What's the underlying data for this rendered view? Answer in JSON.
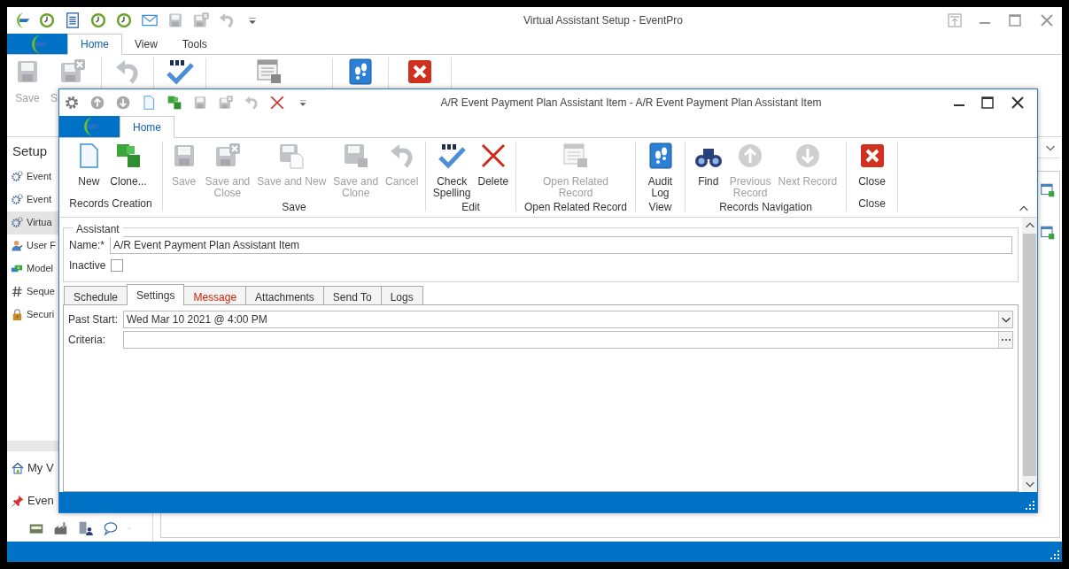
{
  "main_window": {
    "title": "Virtual Assistant Setup - EventPro",
    "ribbon_tabs": [
      {
        "label": "Home",
        "selected": true
      },
      {
        "label": "View",
        "selected": false
      },
      {
        "label": "Tools",
        "selected": false
      }
    ],
    "ribbon_buttons": [
      {
        "label": "Save"
      },
      {
        "label": "S"
      }
    ],
    "sidebar": {
      "title": "Setup",
      "items": [
        {
          "label": "Event",
          "kind": "gear",
          "selected": false
        },
        {
          "label": "Event",
          "kind": "gear",
          "selected": false
        },
        {
          "label": "Virtua",
          "kind": "gear",
          "selected": true
        },
        {
          "label": "User F",
          "kind": "user",
          "selected": false
        },
        {
          "label": "Model",
          "kind": "cash",
          "selected": false
        },
        {
          "label": "Seque",
          "kind": "hash",
          "selected": false
        },
        {
          "label": "Securi",
          "kind": "lock",
          "selected": false
        }
      ],
      "bottom_items": [
        {
          "label": "My V",
          "kind": "home"
        },
        {
          "label": "Even",
          "kind": "pin"
        }
      ]
    }
  },
  "dialog": {
    "title": "A/R Event Payment Plan Assistant Item - A/R Event Payment Plan Assistant Item",
    "ribbon_tabs": [
      {
        "label": "Home",
        "selected": true
      }
    ],
    "ribbon_groups": [
      {
        "label": "Records Creation",
        "buttons": [
          {
            "kind": "new",
            "label": "New",
            "disabled": false
          },
          {
            "kind": "clone",
            "label": "Clone...",
            "disabled": false
          }
        ]
      },
      {
        "label": "Save",
        "buttons": [
          {
            "kind": "save",
            "label": "Save",
            "disabled": true
          },
          {
            "kind": "save-close",
            "label": "Save and\nClose",
            "disabled": true
          },
          {
            "kind": "save-new",
            "label": "Save and New",
            "disabled": true
          },
          {
            "kind": "save-clone",
            "label": "Save and\nClone",
            "disabled": true
          },
          {
            "kind": "undo",
            "label": "Cancel",
            "disabled": true
          }
        ]
      },
      {
        "label": "Edit",
        "buttons": [
          {
            "kind": "spell",
            "label": "Check\nSpelling",
            "disabled": false
          },
          {
            "kind": "delete",
            "label": "Delete",
            "disabled": false
          }
        ]
      },
      {
        "label": "Open Related Record",
        "buttons": [
          {
            "kind": "related",
            "label": "Open Related\nRecord",
            "disabled": true
          }
        ]
      },
      {
        "label": "View",
        "buttons": [
          {
            "kind": "audit",
            "label": "Audit\nLog",
            "disabled": false
          }
        ]
      },
      {
        "label": "Records Navigation",
        "buttons": [
          {
            "kind": "find",
            "label": "Find",
            "disabled": false
          },
          {
            "kind": "up",
            "label": "Previous\nRecord",
            "disabled": true
          },
          {
            "kind": "down",
            "label": "Next Record",
            "disabled": true
          }
        ]
      },
      {
        "label": "Close",
        "buttons": [
          {
            "kind": "close",
            "label": "Close",
            "disabled": false
          }
        ]
      }
    ],
    "assistant": {
      "title": "Assistant",
      "name_label": "Name:*",
      "name": "A/R Event Payment Plan Assistant Item",
      "inactive_label": "Inactive",
      "inactive": false
    },
    "tabs": [
      {
        "label": "Schedule",
        "selected": false,
        "alert": false
      },
      {
        "label": "Settings",
        "selected": true,
        "alert": false
      },
      {
        "label": "Message",
        "selected": false,
        "alert": true
      },
      {
        "label": "Attachments",
        "selected": false,
        "alert": false
      },
      {
        "label": "Send To",
        "selected": false,
        "alert": false
      },
      {
        "label": "Logs",
        "selected": false,
        "alert": false
      }
    ],
    "settings": {
      "past_start_label": "Past Start:",
      "past_start": "Wed Mar 10 2021 @ 4:00 PM",
      "criteria_label": "Criteria:"
    }
  }
}
